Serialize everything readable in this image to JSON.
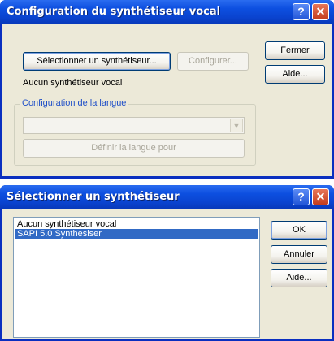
{
  "window1": {
    "title": "Configuration du synthétiseur vocal",
    "help_label": "?",
    "close_label": "✕",
    "select_synth_button": "Sélectionner un synthétiseur...",
    "configure_button": "Configurer...",
    "close_button": "Fermer",
    "help_button": "Aide...",
    "status_text": "Aucun synthétiseur vocal",
    "language_group_label": "Configuration de la langue",
    "language_combo_value": "",
    "set_language_button": "Définir la langue pour"
  },
  "window2": {
    "title": "Sélectionner un synthétiseur",
    "help_label": "?",
    "close_label": "✕",
    "list_items": [
      {
        "label": "Aucun synthétiseur vocal",
        "selected": false
      },
      {
        "label": "SAPI 5.0 Synthesiser",
        "selected": true
      }
    ],
    "ok_button": "OK",
    "cancel_button": "Annuler",
    "help_button": "Aide..."
  },
  "colors": {
    "titlebar": "#0a44d0",
    "client": "#ece9d8",
    "selection": "#316ac5",
    "group_label": "#1f4fc8"
  }
}
